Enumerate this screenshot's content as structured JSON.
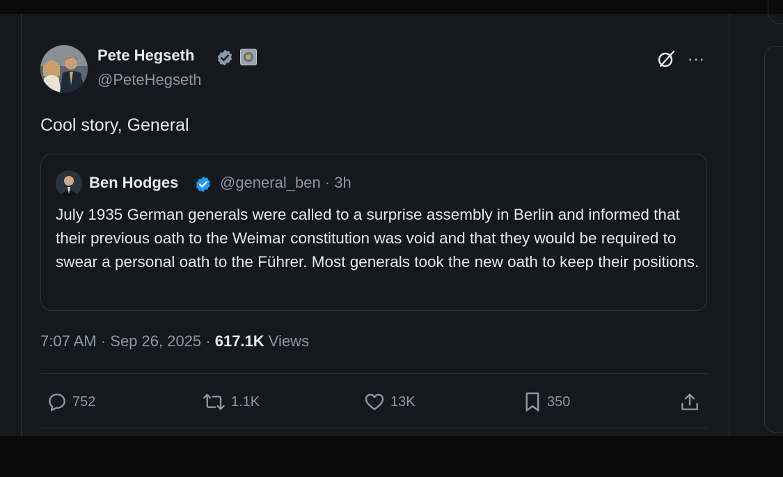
{
  "tweet": {
    "author_name": "Pete Hegseth",
    "author_handle": "@PeteHegseth",
    "text": "Cool story, General",
    "timestamp": "7:07 AM · Sep 26, 2025 · ",
    "views_count": "617.1K",
    "views_label": " Views"
  },
  "quote": {
    "author_name": "Ben Hodges",
    "author_handle": "@general_ben · 3h",
    "text": "July 1935 German generals were called to a surprise assembly in Berlin and informed that their previous oath to the Weimar constitution was void and that they would be required to swear a personal oath to the Führer. Most generals took the new oath to keep their positions."
  },
  "actions": {
    "replies": "752",
    "reposts": "1.1K",
    "likes": "13K",
    "bookmarks": "350"
  },
  "colors": {
    "background": "#15181d",
    "text": "#e7e9ea",
    "secondary_text": "#8b98a5",
    "verified": "#1d9bf0",
    "border": "#2f3336"
  },
  "icons": [
    "verified-badge-icon",
    "affiliation-badge-icon",
    "grok-icon",
    "more-icon",
    "reply-icon",
    "repost-icon",
    "like-icon",
    "bookmark-icon",
    "share-icon"
  ]
}
